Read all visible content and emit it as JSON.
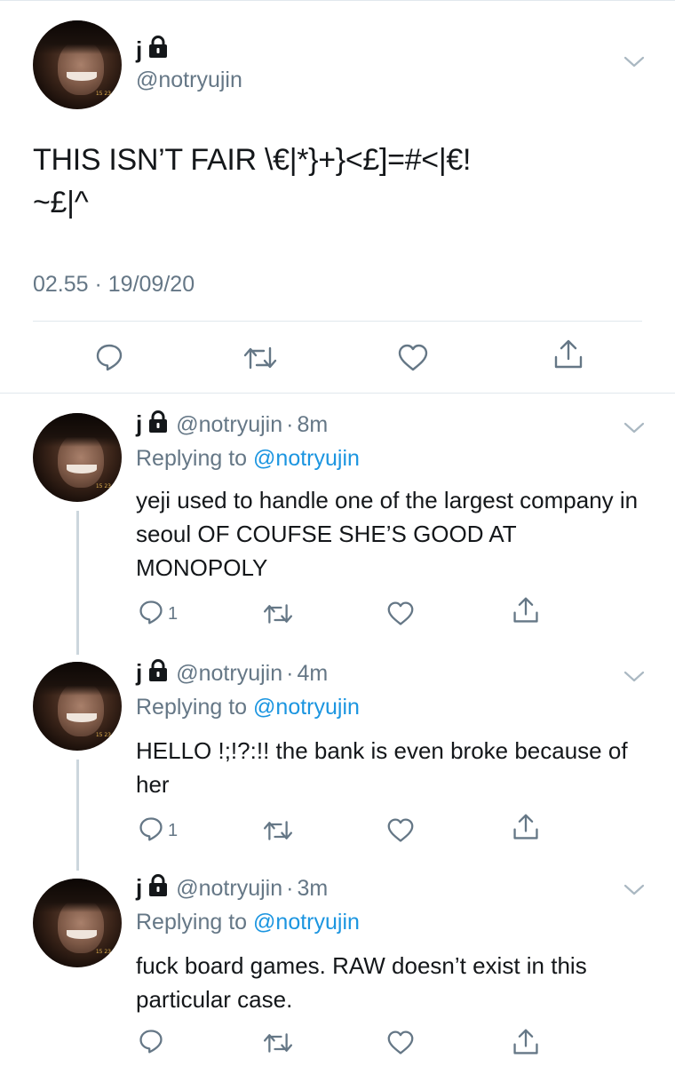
{
  "main_tweet": {
    "name": "j",
    "handle": "@notryujin",
    "text_line1": "THIS ISN’T FAIR \\€|*}+}<£]=#<|€!",
    "text_line2": "~£|^",
    "timestamp": "02.55 · 19/09/20",
    "icons": [
      "lock-icon",
      "chevron-down-icon",
      "reply-icon",
      "retweet-icon",
      "like-icon",
      "share-icon"
    ]
  },
  "replies": [
    {
      "name": "j",
      "handle": "@notryujin",
      "dot": "·",
      "time": "8m",
      "replying_prefix": "Replying to",
      "replying_to": "@notryujin",
      "text": "yeji used to handle one of the largest company in seoul OF COUFSE SHE’S GOOD AT MONOPOLY",
      "reply_count": "1"
    },
    {
      "name": "j",
      "handle": "@notryujin",
      "dot": "·",
      "time": "4m",
      "replying_prefix": "Replying to",
      "replying_to": "@notryujin",
      "text": "HELLO !;!?:!! the bank is even broke because of her",
      "reply_count": "1"
    },
    {
      "name": "j",
      "handle": "@notryujin",
      "dot": "·",
      "time": "3m",
      "replying_prefix": "Replying to",
      "replying_to": "@notryujin",
      "text": "fuck board games. RAW doesn’t exist in this particular case.",
      "reply_count": ""
    }
  ],
  "colors": {
    "text": "#14171a",
    "secondary": "#657786",
    "link": "#1b95e0",
    "divider": "#e1e8ed",
    "thread_line": "#ccd6dd"
  }
}
